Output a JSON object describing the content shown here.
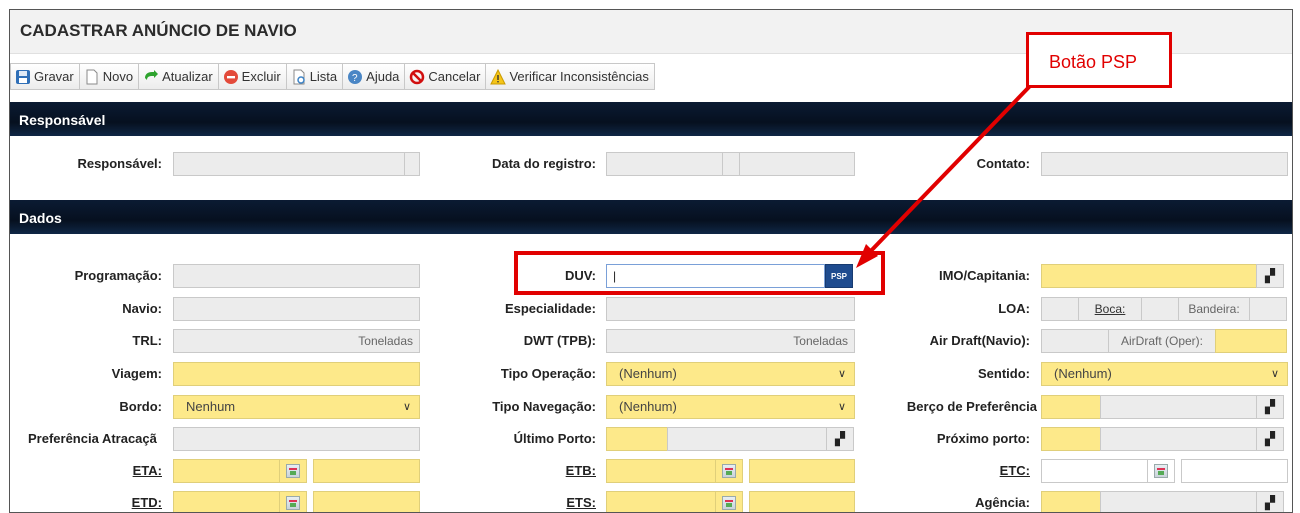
{
  "title": "CADASTRAR ANÚNCIO DE NAVIO",
  "toolbar": [
    {
      "label": "Gravar",
      "icon": "save-icon"
    },
    {
      "label": "Novo",
      "icon": "new-document-icon"
    },
    {
      "label": "Atualizar",
      "icon": "refresh-arrow-icon"
    },
    {
      "label": "Excluir",
      "icon": "delete-icon"
    },
    {
      "label": "Lista",
      "icon": "list-icon"
    },
    {
      "label": "Ajuda",
      "icon": "help-icon"
    },
    {
      "label": "Cancelar",
      "icon": "cancel-icon"
    },
    {
      "label": "Verificar Inconsistências",
      "icon": "warning-icon"
    }
  ],
  "sections": {
    "responsavel": "Responsável",
    "dados": "Dados"
  },
  "responsavel": {
    "responsavel_label": "Responsável:",
    "data_registro_label": "Data do registro:",
    "contato_label": "Contato:"
  },
  "dados": {
    "programacao": "Programação:",
    "navio": "Navio:",
    "trl": "TRL:",
    "toneladas": "Toneladas",
    "viagem": "Viagem:",
    "bordo": "Bordo:",
    "bordo_value": "Nenhum",
    "preferencia_atracacao": "Preferência Atracaçã",
    "eta": "ETA:",
    "etd": "ETD:",
    "duv": "DUV:",
    "psp": "PSP",
    "especialidade": "Especialidade:",
    "dwt": "DWT (TPB):",
    "tipo_operacao": "Tipo Operação:",
    "tipo_operacao_value": "(Nenhum)",
    "tipo_navegacao": "Tipo Navegação:",
    "tipo_navegacao_value": "(Nenhum)",
    "ultimo_porto": "Último Porto:",
    "etb": "ETB:",
    "ets": "ETS:",
    "imo": "IMO/Capitania:",
    "loa": "LOA:",
    "boca": "Boca:",
    "bandeira": "Bandeira:",
    "air_draft": "Air Draft(Navio):",
    "air_draft_oper": "AirDraft (Oper):",
    "sentido": "Sentido:",
    "sentido_value": "(Nenhum)",
    "berco": "Berço de Preferência",
    "proximo_porto": "Próximo porto:",
    "etc": "ETC:",
    "agencia": "Agência:"
  },
  "annotation": {
    "label": "Botão PSP",
    "color": "#e10000"
  },
  "colors": {
    "required_field": "#fde98a",
    "section_header": "#0b1b33",
    "psp_button": "#1f4c8f"
  }
}
